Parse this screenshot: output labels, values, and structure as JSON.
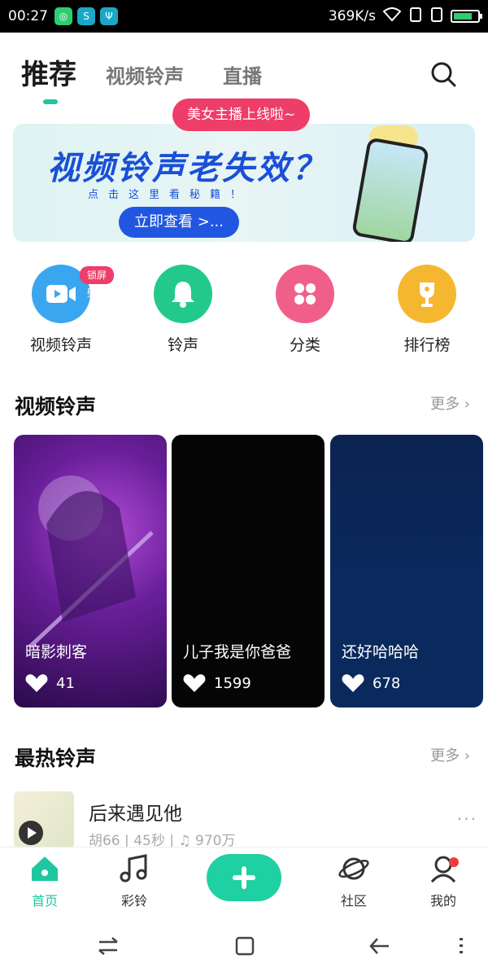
{
  "status_bar": {
    "time": "00:27",
    "network_speed": "369K/s",
    "battery_color": "#2ecc71"
  },
  "top_tabs": [
    {
      "label": "推荐",
      "active": true
    },
    {
      "label": "视频铃声",
      "active": false
    },
    {
      "label": "直播",
      "active": false
    }
  ],
  "accent_color": "#1fc7a0",
  "banner": {
    "live_pill": "美女主播上线啦~",
    "title": "视频铃声老失效？",
    "subtitle": "点击这里看秘籍！",
    "button": "立即查看 >..."
  },
  "quick_entries": [
    {
      "label": "视频铃声",
      "icon": "video-camera-icon",
      "color": "#3aa6f0",
      "badge": "锁屏壁纸"
    },
    {
      "label": "铃声",
      "icon": "bell-icon",
      "color": "#22c98b"
    },
    {
      "label": "分类",
      "icon": "grid-dots-icon",
      "color": "#f05f8a"
    },
    {
      "label": "排行榜",
      "icon": "trophy-icon",
      "color": "#f6b730"
    }
  ],
  "video_section": {
    "title": "视频铃声",
    "more": "更多",
    "cards": [
      {
        "title": "暗影刺客",
        "likes": "41"
      },
      {
        "title": "儿子我是你爸爸",
        "likes": "1599"
      },
      {
        "title": "还好哈哈哈",
        "likes": "678"
      }
    ]
  },
  "hot_section": {
    "title": "最热铃声",
    "more": "更多",
    "items": [
      {
        "name": "后来遇见他",
        "artist": "胡66",
        "duration": "45秒",
        "plays": "970万"
      }
    ]
  },
  "bottom_tabs": [
    {
      "label": "首页",
      "icon": "home-icon",
      "active": true
    },
    {
      "label": "彩铃",
      "icon": "music-note-icon",
      "active": false
    },
    {
      "label": "",
      "icon": "plus-icon",
      "active": false
    },
    {
      "label": "社区",
      "icon": "planet-icon",
      "active": false
    },
    {
      "label": "我的",
      "icon": "person-icon",
      "active": false
    }
  ]
}
